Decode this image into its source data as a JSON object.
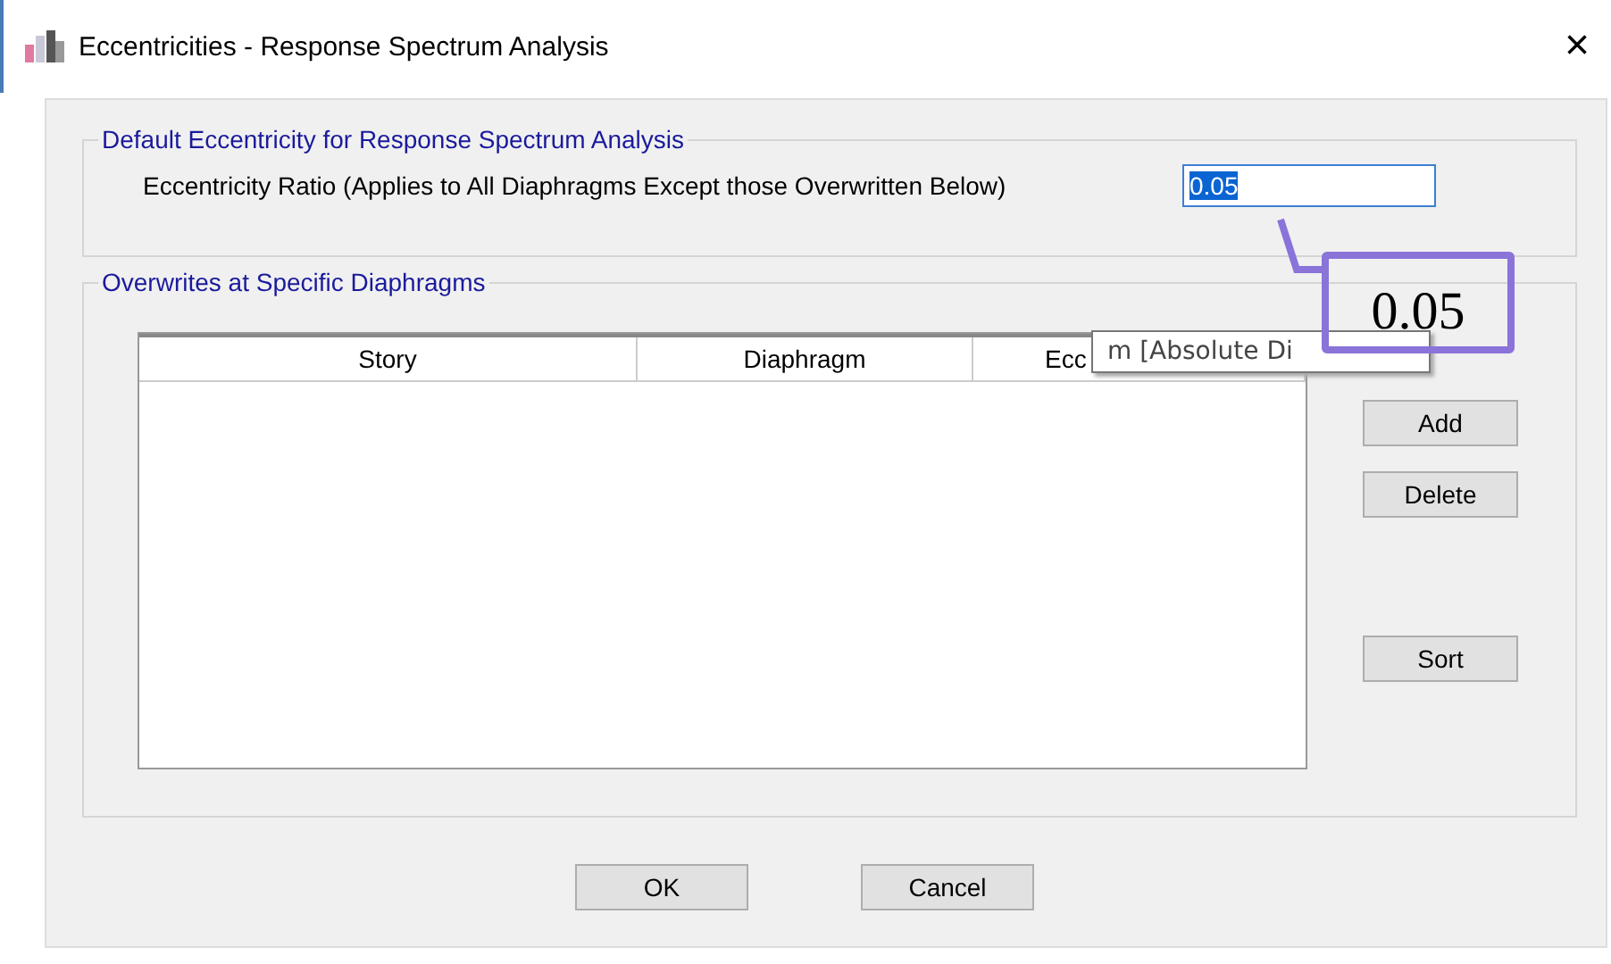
{
  "window": {
    "title": "Eccentricities - Response Spectrum Analysis",
    "close": "×"
  },
  "default_group": {
    "title": "Default Eccentricity for Response Spectrum Analysis",
    "label": "Eccentricity Ratio (Applies to All Diaphragms Except those Overwritten Below)",
    "value": "0.05"
  },
  "overwrites_group": {
    "title": "Overwrites at Specific Diaphragms",
    "table": {
      "columns": [
        "Story",
        "Diaphragm",
        "Ecc"
      ]
    },
    "tooltip": "m  [Absolute Di",
    "buttons": [
      "Add",
      "Delete",
      "Sort"
    ]
  },
  "callout": {
    "text": "0.05"
  },
  "buttons": [
    "OK",
    "Cancel"
  ]
}
